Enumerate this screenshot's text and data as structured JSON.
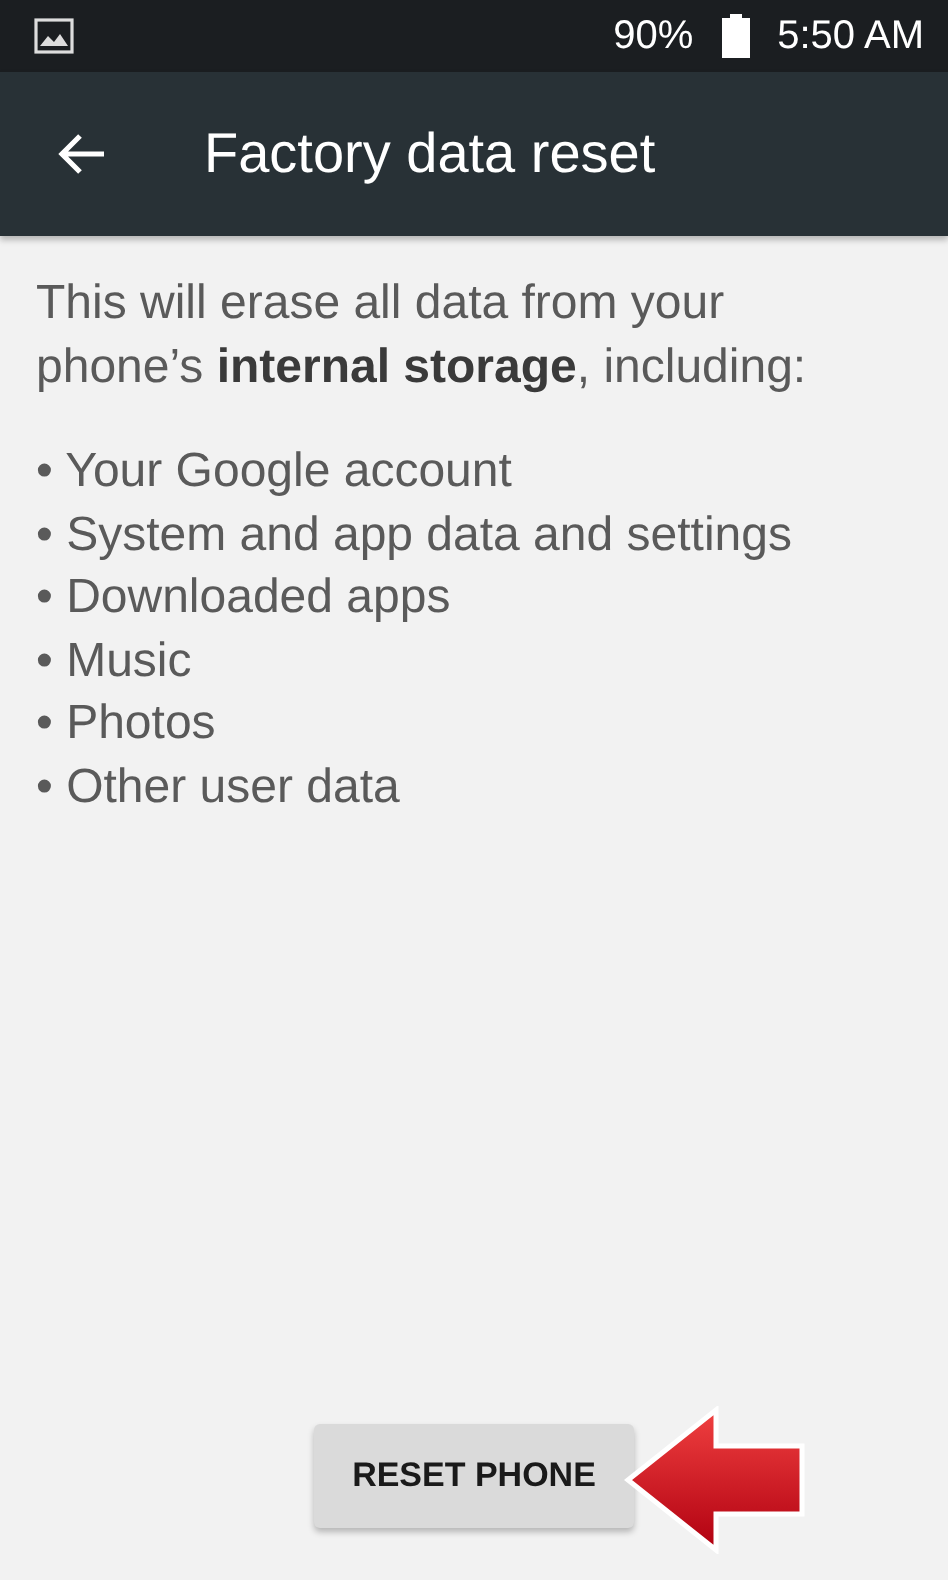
{
  "status_bar": {
    "battery": "90%",
    "time": "5:50 AM"
  },
  "app_bar": {
    "title": "Factory data reset"
  },
  "intro": "This will erase all data from your phone’s **internal storage**, including:",
  "items": [
    "• Your Google account",
    "• System and app data and settings",
    "• Downloaded apps",
    "• Music",
    "• Photos",
    "• Other user data"
  ],
  "button": "RESET PHONE"
}
